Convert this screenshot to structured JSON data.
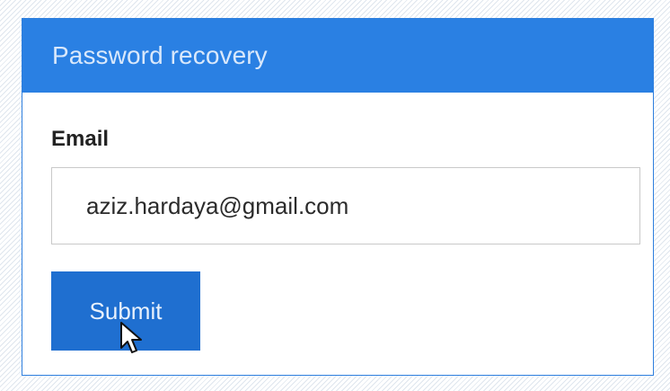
{
  "panel": {
    "title": "Password recovery",
    "header_color": "#2a80e3"
  },
  "form": {
    "email_label": "Email",
    "email_value": "aziz.hardaya@gmail.com",
    "submit_label": "Submit",
    "button_color": "#1f6fd0"
  },
  "cursor": {
    "icon": "arrow-pointer-icon"
  }
}
